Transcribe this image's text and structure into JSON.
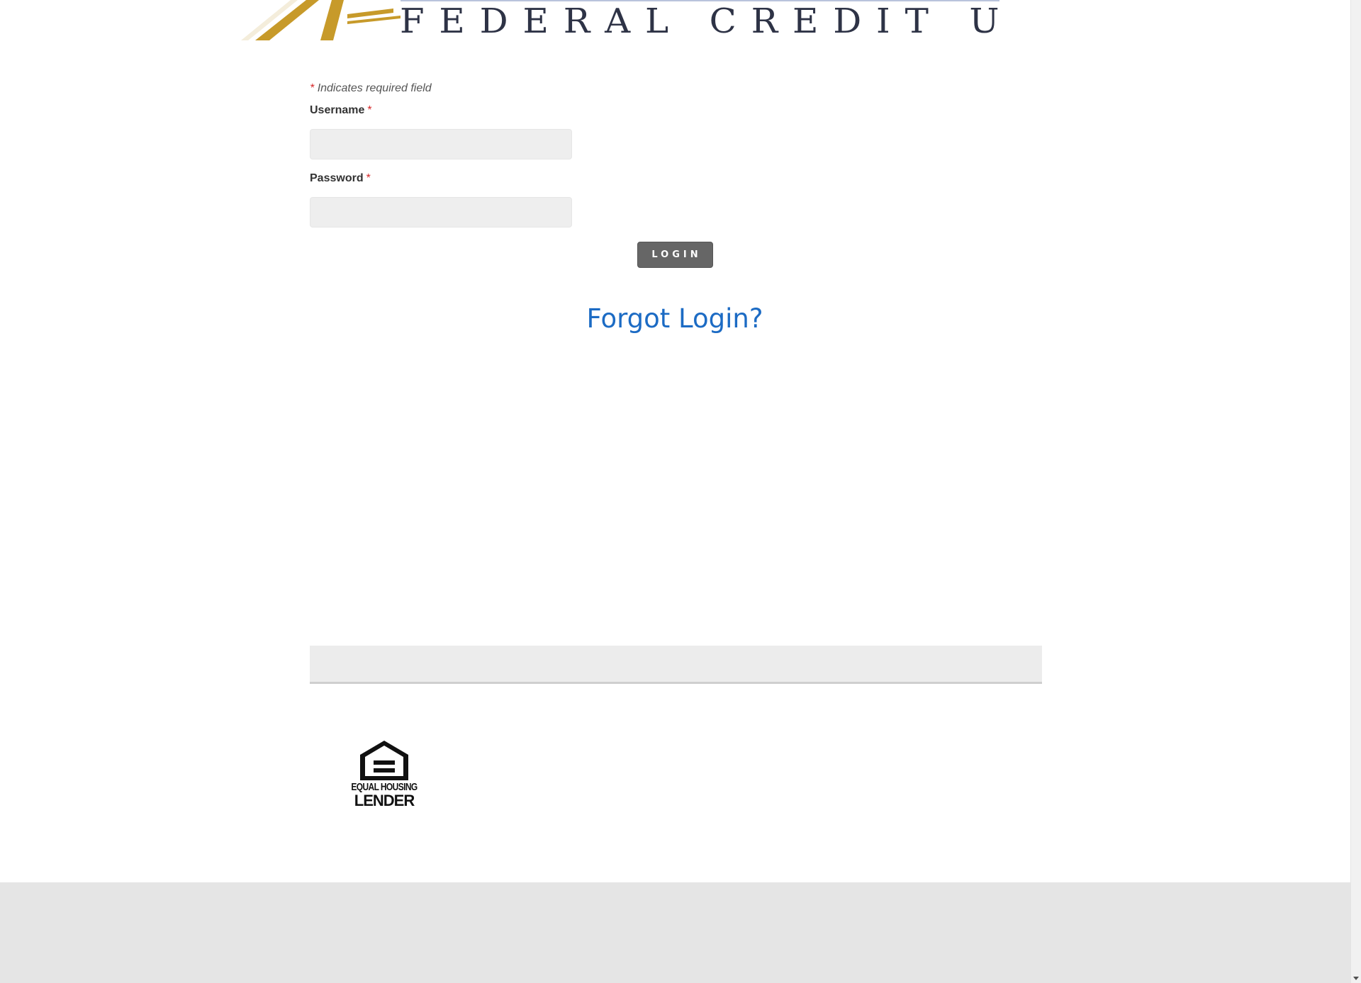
{
  "header": {
    "logo_text": "FEDERAL CREDIT UNION",
    "logo_gold": "#c79a2a",
    "logo_navy": "#2e3346"
  },
  "form": {
    "required_note_star": "*",
    "required_note_text": "Indicates required field",
    "username_label": "Username",
    "password_label": "Password",
    "required_star": "*",
    "username_value": "",
    "password_value": "",
    "login_label": "LOGIN",
    "forgot_label": "Forgot Login?"
  },
  "badge": {
    "icon": "equal-housing-icon",
    "line1": "EQUAL HOUSING",
    "line2": "LENDER"
  },
  "colors": {
    "link": "#1c6bc4",
    "button": "#666666",
    "required": "#d62728",
    "footer": "#e5e5e5"
  }
}
